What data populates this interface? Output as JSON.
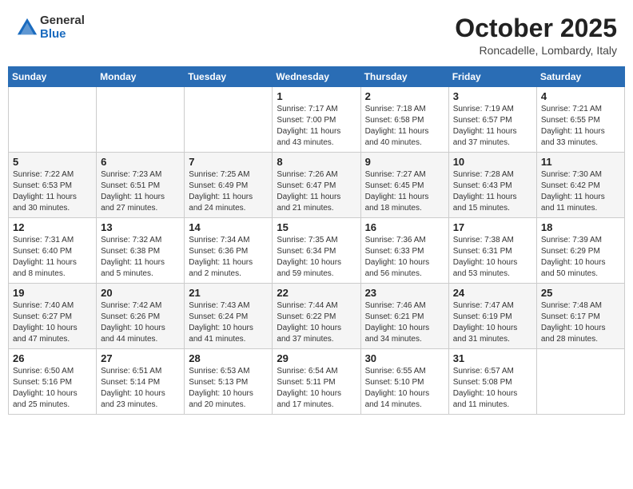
{
  "header": {
    "logo_general": "General",
    "logo_blue": "Blue",
    "month_title": "October 2025",
    "location": "Roncadelle, Lombardy, Italy"
  },
  "days_of_week": [
    "Sunday",
    "Monday",
    "Tuesday",
    "Wednesday",
    "Thursday",
    "Friday",
    "Saturday"
  ],
  "weeks": [
    [
      {
        "day": "",
        "info": ""
      },
      {
        "day": "",
        "info": ""
      },
      {
        "day": "",
        "info": ""
      },
      {
        "day": "1",
        "info": "Sunrise: 7:17 AM\nSunset: 7:00 PM\nDaylight: 11 hours\nand 43 minutes."
      },
      {
        "day": "2",
        "info": "Sunrise: 7:18 AM\nSunset: 6:58 PM\nDaylight: 11 hours\nand 40 minutes."
      },
      {
        "day": "3",
        "info": "Sunrise: 7:19 AM\nSunset: 6:57 PM\nDaylight: 11 hours\nand 37 minutes."
      },
      {
        "day": "4",
        "info": "Sunrise: 7:21 AM\nSunset: 6:55 PM\nDaylight: 11 hours\nand 33 minutes."
      }
    ],
    [
      {
        "day": "5",
        "info": "Sunrise: 7:22 AM\nSunset: 6:53 PM\nDaylight: 11 hours\nand 30 minutes."
      },
      {
        "day": "6",
        "info": "Sunrise: 7:23 AM\nSunset: 6:51 PM\nDaylight: 11 hours\nand 27 minutes."
      },
      {
        "day": "7",
        "info": "Sunrise: 7:25 AM\nSunset: 6:49 PM\nDaylight: 11 hours\nand 24 minutes."
      },
      {
        "day": "8",
        "info": "Sunrise: 7:26 AM\nSunset: 6:47 PM\nDaylight: 11 hours\nand 21 minutes."
      },
      {
        "day": "9",
        "info": "Sunrise: 7:27 AM\nSunset: 6:45 PM\nDaylight: 11 hours\nand 18 minutes."
      },
      {
        "day": "10",
        "info": "Sunrise: 7:28 AM\nSunset: 6:43 PM\nDaylight: 11 hours\nand 15 minutes."
      },
      {
        "day": "11",
        "info": "Sunrise: 7:30 AM\nSunset: 6:42 PM\nDaylight: 11 hours\nand 11 minutes."
      }
    ],
    [
      {
        "day": "12",
        "info": "Sunrise: 7:31 AM\nSunset: 6:40 PM\nDaylight: 11 hours\nand 8 minutes."
      },
      {
        "day": "13",
        "info": "Sunrise: 7:32 AM\nSunset: 6:38 PM\nDaylight: 11 hours\nand 5 minutes."
      },
      {
        "day": "14",
        "info": "Sunrise: 7:34 AM\nSunset: 6:36 PM\nDaylight: 11 hours\nand 2 minutes."
      },
      {
        "day": "15",
        "info": "Sunrise: 7:35 AM\nSunset: 6:34 PM\nDaylight: 10 hours\nand 59 minutes."
      },
      {
        "day": "16",
        "info": "Sunrise: 7:36 AM\nSunset: 6:33 PM\nDaylight: 10 hours\nand 56 minutes."
      },
      {
        "day": "17",
        "info": "Sunrise: 7:38 AM\nSunset: 6:31 PM\nDaylight: 10 hours\nand 53 minutes."
      },
      {
        "day": "18",
        "info": "Sunrise: 7:39 AM\nSunset: 6:29 PM\nDaylight: 10 hours\nand 50 minutes."
      }
    ],
    [
      {
        "day": "19",
        "info": "Sunrise: 7:40 AM\nSunset: 6:27 PM\nDaylight: 10 hours\nand 47 minutes."
      },
      {
        "day": "20",
        "info": "Sunrise: 7:42 AM\nSunset: 6:26 PM\nDaylight: 10 hours\nand 44 minutes."
      },
      {
        "day": "21",
        "info": "Sunrise: 7:43 AM\nSunset: 6:24 PM\nDaylight: 10 hours\nand 41 minutes."
      },
      {
        "day": "22",
        "info": "Sunrise: 7:44 AM\nSunset: 6:22 PM\nDaylight: 10 hours\nand 37 minutes."
      },
      {
        "day": "23",
        "info": "Sunrise: 7:46 AM\nSunset: 6:21 PM\nDaylight: 10 hours\nand 34 minutes."
      },
      {
        "day": "24",
        "info": "Sunrise: 7:47 AM\nSunset: 6:19 PM\nDaylight: 10 hours\nand 31 minutes."
      },
      {
        "day": "25",
        "info": "Sunrise: 7:48 AM\nSunset: 6:17 PM\nDaylight: 10 hours\nand 28 minutes."
      }
    ],
    [
      {
        "day": "26",
        "info": "Sunrise: 6:50 AM\nSunset: 5:16 PM\nDaylight: 10 hours\nand 25 minutes."
      },
      {
        "day": "27",
        "info": "Sunrise: 6:51 AM\nSunset: 5:14 PM\nDaylight: 10 hours\nand 23 minutes."
      },
      {
        "day": "28",
        "info": "Sunrise: 6:53 AM\nSunset: 5:13 PM\nDaylight: 10 hours\nand 20 minutes."
      },
      {
        "day": "29",
        "info": "Sunrise: 6:54 AM\nSunset: 5:11 PM\nDaylight: 10 hours\nand 17 minutes."
      },
      {
        "day": "30",
        "info": "Sunrise: 6:55 AM\nSunset: 5:10 PM\nDaylight: 10 hours\nand 14 minutes."
      },
      {
        "day": "31",
        "info": "Sunrise: 6:57 AM\nSunset: 5:08 PM\nDaylight: 10 hours\nand 11 minutes."
      },
      {
        "day": "",
        "info": ""
      }
    ]
  ]
}
